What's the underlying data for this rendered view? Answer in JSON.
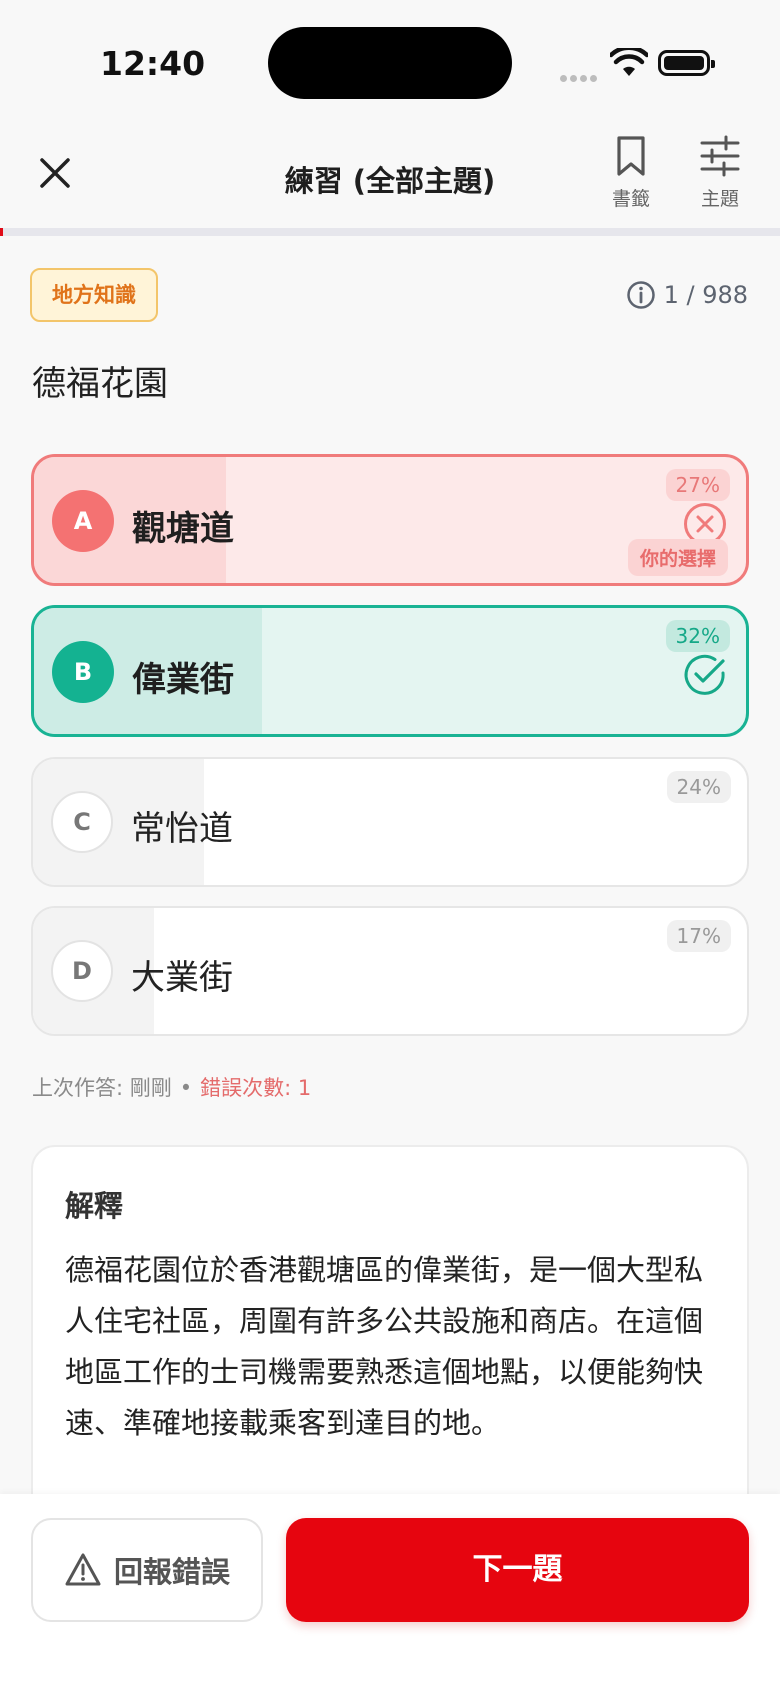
{
  "status_bar": {
    "time": "12:40"
  },
  "header": {
    "title": "練習 (全部主題)",
    "bookmark_label": "書籤",
    "topic_label": "主題"
  },
  "progress": {
    "fraction": 0.001
  },
  "question": {
    "category": "地方知識",
    "counter": "1 / 988",
    "text": "德福花園"
  },
  "options": [
    {
      "letter": "A",
      "label": "觀塘道",
      "percent": "27%",
      "percent_value": 27,
      "state": "selected-wrong",
      "tag": "你的選擇"
    },
    {
      "letter": "B",
      "label": "偉業街",
      "percent": "32%",
      "percent_value": 32,
      "state": "correct"
    },
    {
      "letter": "C",
      "label": "常怡道",
      "percent": "24%",
      "percent_value": 24,
      "state": "neutral"
    },
    {
      "letter": "D",
      "label": "大業街",
      "percent": "17%",
      "percent_value": 17,
      "state": "neutral"
    }
  ],
  "answer_meta": {
    "last_answered": "上次作答: 剛剛",
    "separator": "•",
    "wrong_count": "錯誤次數: 1"
  },
  "explanation": {
    "title": "解釋",
    "body": "德福花園位於香港觀塘區的偉業街，是一個大型私人住宅社區，周圍有許多公共設施和商店。在這個地區工作的士司機需要熟悉這個地點，以便能夠快速、準確地接載乘客到達目的地。"
  },
  "footer": {
    "report_label": "回報錯誤",
    "next_label": "下一題"
  },
  "colors": {
    "accent": "#e6050f",
    "correct": "#14b291",
    "wrong": "#f47272",
    "badge": "#e0731a"
  }
}
